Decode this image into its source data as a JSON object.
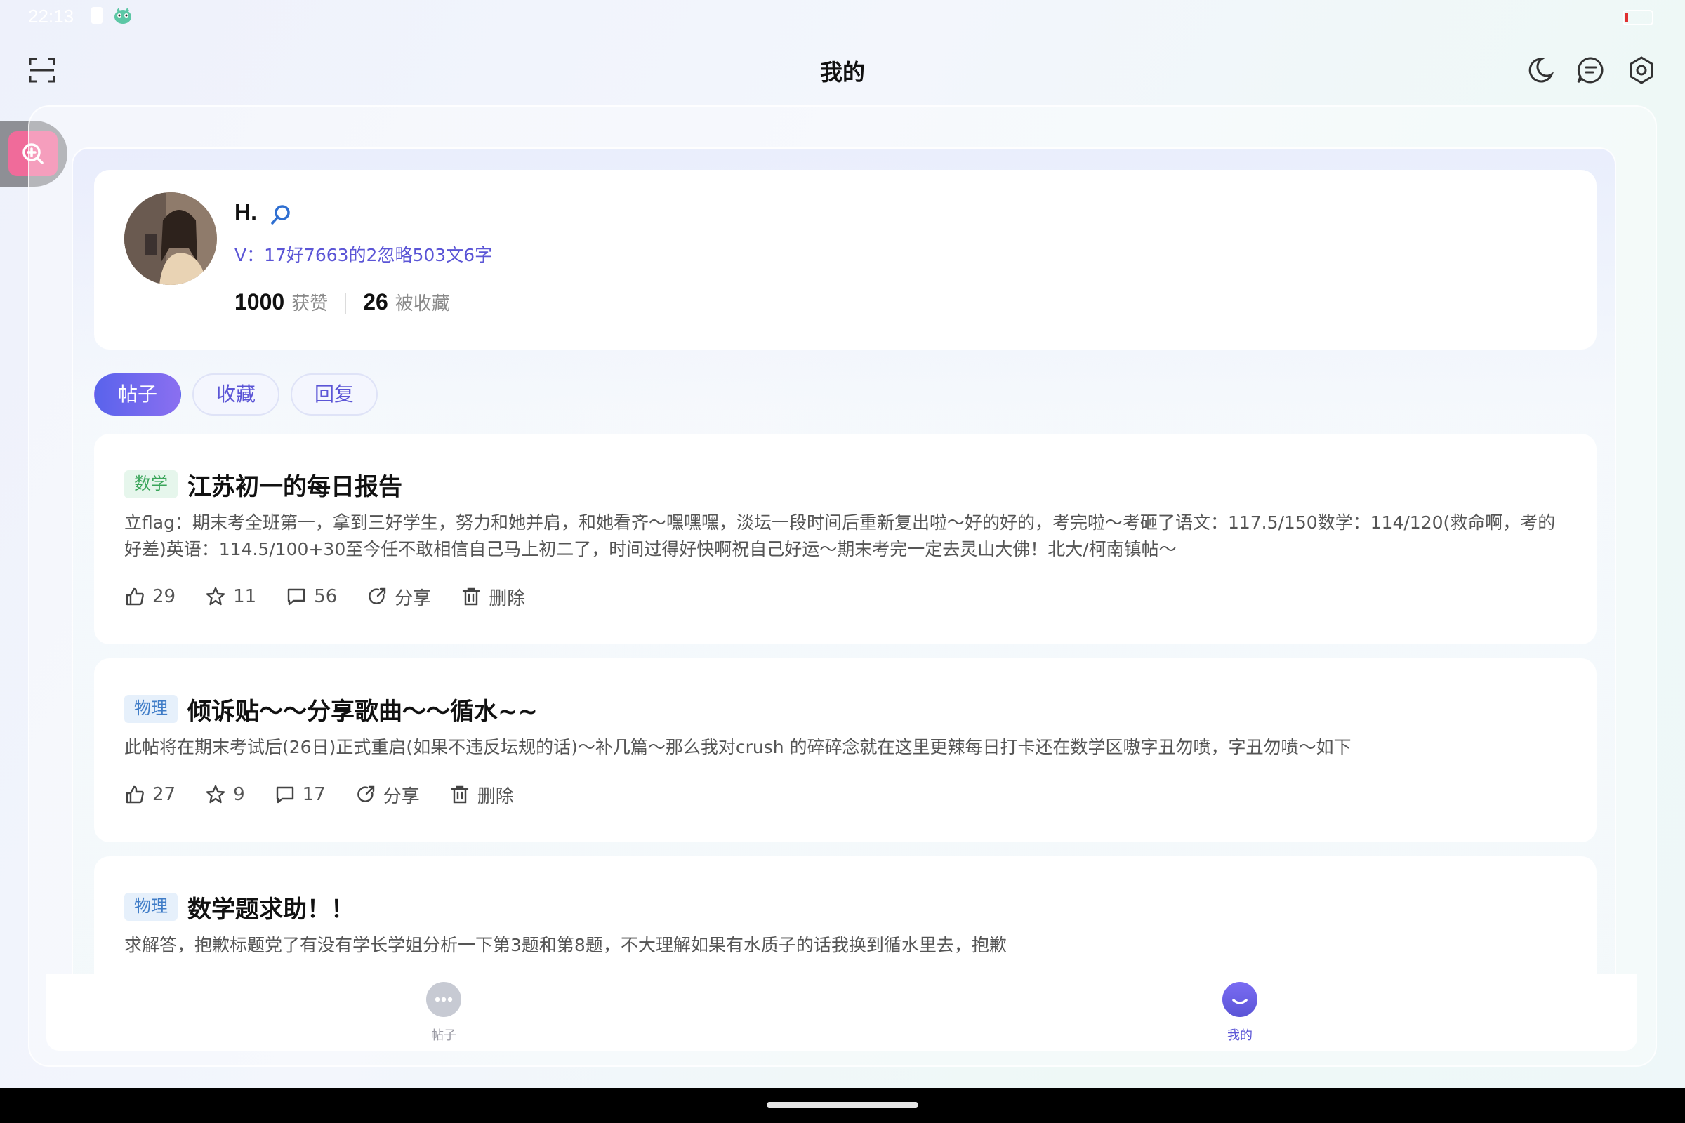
{
  "status": {
    "time": "22:13"
  },
  "header": {
    "title": "我的"
  },
  "profile": {
    "name": "H.",
    "bio": "V：17好7663的2忽略503文6字",
    "likes_count": "1000",
    "likes_label": "获赞",
    "favorited_count": "26",
    "favorited_label": "被收藏"
  },
  "tabs": [
    {
      "label": "帖子",
      "active": true
    },
    {
      "label": "收藏",
      "active": false
    },
    {
      "label": "回复",
      "active": false
    }
  ],
  "posts": [
    {
      "tag": "数学",
      "title": "江苏初一的每日报告",
      "body": "立flag：期末考全班第一，拿到三好学生，努力和她并肩，和她看齐～嘿嘿嘿，淡坛一段时间后重新复出啦～好的好的，考完啦～考砸了语文：117.5/150数学：114/120(救命啊，考的好差)英语：114.5/100+30至今任不敢相信自己马上初二了，时间过得好快啊祝自己好运～期末考完一定去灵山大佛！北大/柯南镇帖～",
      "likes": "29",
      "stars": "11",
      "comments": "56",
      "share_label": "分享",
      "delete_label": "删除"
    },
    {
      "tag": "物理",
      "title": "倾诉贴～～分享歌曲～～循水~~",
      "body": "此帖将在期末考试后(26日)正式重启(如果不违反坛规的话)～补几篇～那么我对crush 的碎碎念就在这里更辣每日打卡还在数学区嗷字丑勿喷，字丑勿喷～如下",
      "likes": "27",
      "stars": "9",
      "comments": "17",
      "share_label": "分享",
      "delete_label": "删除"
    },
    {
      "tag": "物理",
      "title": "数学题求助！！",
      "body": "求解答，抱歉标题党了有没有学长学姐分析一下第3题和第8题，不大理解如果有水质子的话我换到循水里去，抱歉"
    }
  ],
  "bottom_nav": [
    {
      "label": "帖子",
      "icon": "chat-bubble-icon",
      "active": false
    },
    {
      "label": "我的",
      "icon": "profile-face-icon",
      "active": true
    }
  ],
  "colors": {
    "accent": "#5b55d6",
    "tab_active_start": "#5a63ec",
    "tab_active_end": "#8a6ff0",
    "tag_green": "#3aa55a",
    "tag_blue": "#3f7cc7",
    "float_search": "#f06b9a",
    "battery_low": "#e03030"
  }
}
